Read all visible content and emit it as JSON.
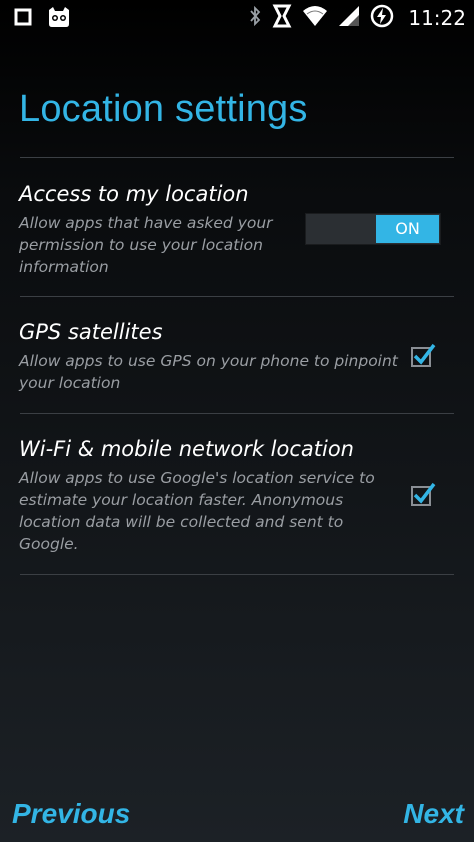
{
  "status_bar": {
    "time": "11:22",
    "left_icons": [
      "square-notification-icon",
      "cyanogen-mascot-icon"
    ],
    "right_icons": [
      "bluetooth-icon",
      "nfc-icon",
      "wifi-icon",
      "signal-icon",
      "battery-charging-icon"
    ]
  },
  "page": {
    "title": "Location settings"
  },
  "settings": [
    {
      "title": "Access to my location",
      "summary_lines": [
        "Allow apps that have asked your",
        "permission to use your location",
        "information"
      ],
      "control": "toggle",
      "toggle_label": "ON",
      "checked": true
    },
    {
      "title": "GPS satellites",
      "summary_lines": [
        "Allow apps to use GPS on your phone to pinpoint",
        "your location"
      ],
      "control": "checkbox",
      "checked": true
    },
    {
      "title": "Wi-Fi & mobile network location",
      "summary_lines": [
        "Allow apps to use Google's location service to",
        "estimate your location faster. Anonymous",
        "location data will be collected and sent to",
        "Google."
      ],
      "control": "checkbox",
      "checked": true
    }
  ],
  "footer": {
    "previous_label": "Previous",
    "next_label": "Next"
  },
  "colors": {
    "accent": "#33b5e5",
    "summary_text": "#9a9ea3",
    "divider": "#3b3f44"
  }
}
